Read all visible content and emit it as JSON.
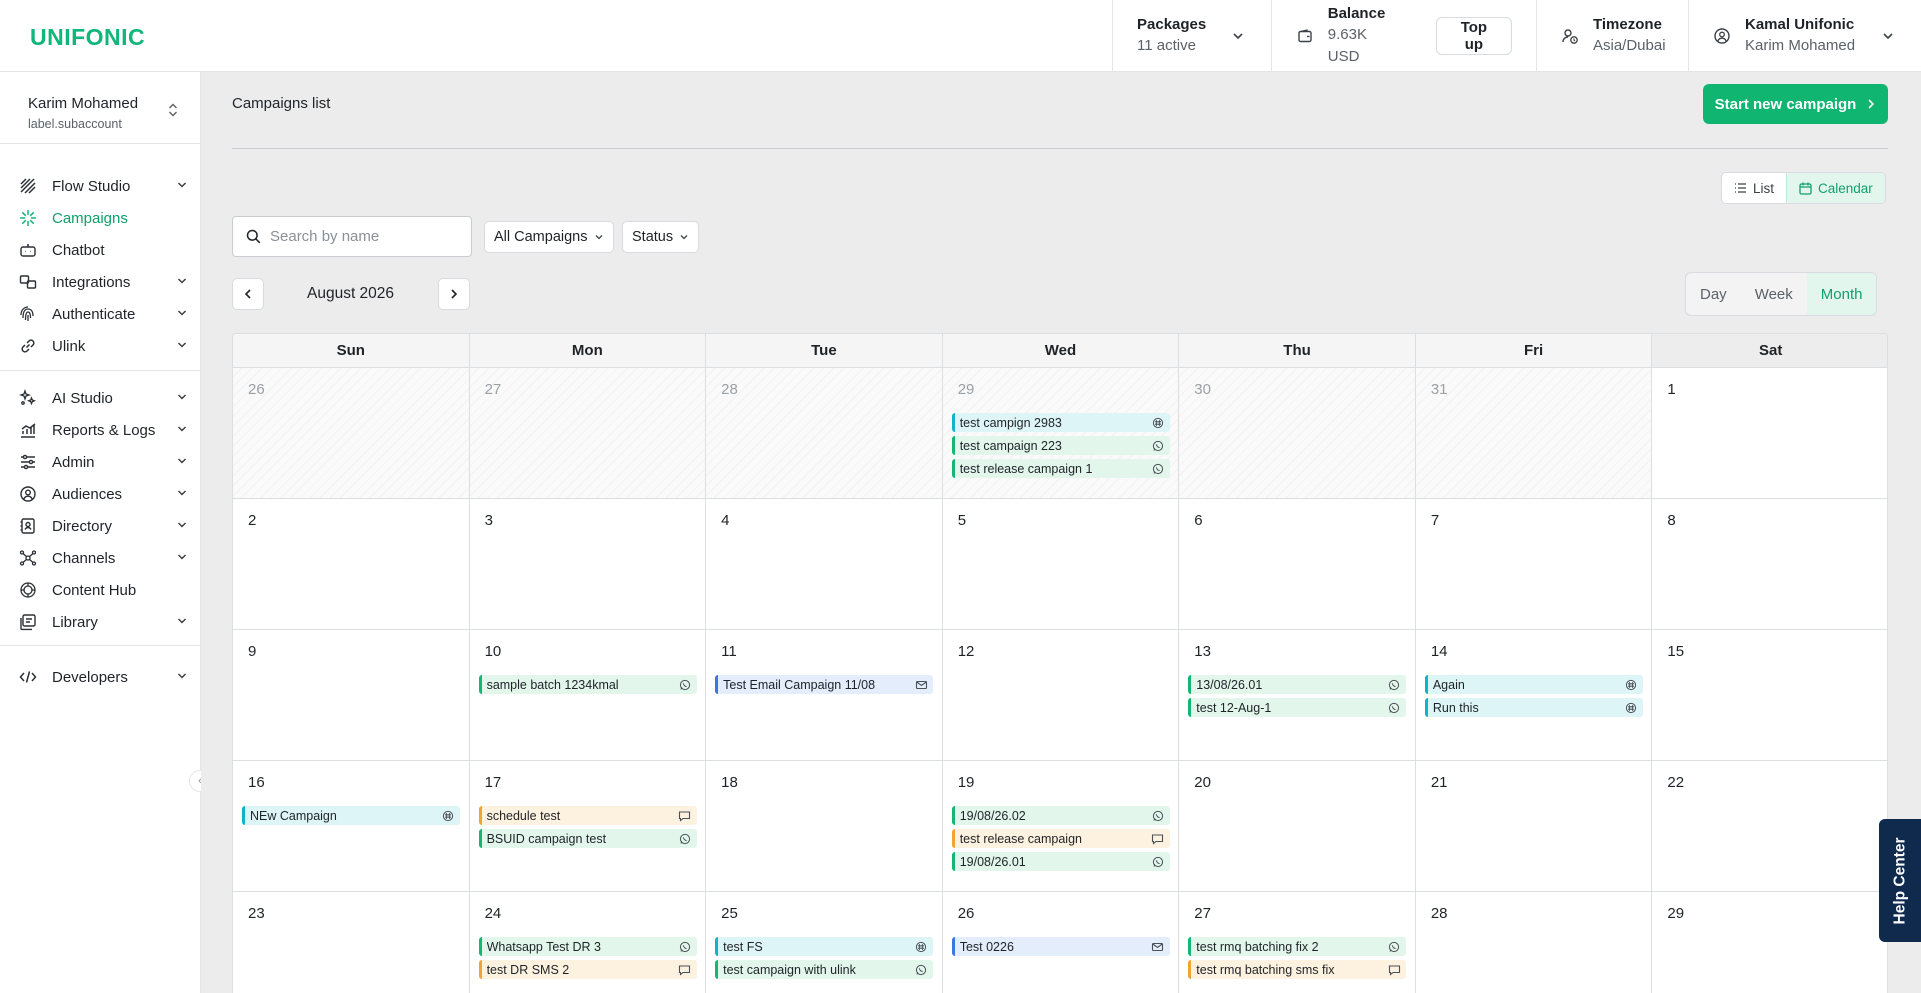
{
  "brand": {
    "logo": "UNIFONIC",
    "accent": "#11b67a",
    "primary_button": "#0fb571"
  },
  "topbar": {
    "packages": {
      "label": "Packages",
      "value": "11 active"
    },
    "balance": {
      "label": "Balance",
      "value": "9.63K USD",
      "topup": "Top up"
    },
    "timezone": {
      "label": "Timezone",
      "value": "Asia/Dubai"
    },
    "user": {
      "name": "Kamal Unifonic",
      "account": "Karim Mohamed"
    }
  },
  "sidebar": {
    "account": {
      "name": "Karim Mohamed",
      "sub": "label.subaccount"
    },
    "items": [
      {
        "label": "Flow Studio",
        "icon": "flow-studio-icon",
        "expandable": true
      },
      {
        "label": "Campaigns",
        "icon": "campaigns-icon",
        "expandable": false,
        "active": true
      },
      {
        "label": "Chatbot",
        "icon": "chatbot-icon",
        "expandable": false
      },
      {
        "label": "Integrations",
        "icon": "integrations-icon",
        "expandable": true
      },
      {
        "label": "Authenticate",
        "icon": "fingerprint-icon",
        "expandable": true
      },
      {
        "label": "Ulink",
        "icon": "link-icon",
        "expandable": true
      },
      {
        "label": "AI Studio",
        "icon": "ai-studio-icon",
        "expandable": true
      },
      {
        "label": "Reports & Logs",
        "icon": "reports-icon",
        "expandable": true
      },
      {
        "label": "Admin",
        "icon": "sliders-icon",
        "expandable": true
      },
      {
        "label": "Audiences",
        "icon": "audiences-icon",
        "expandable": true
      },
      {
        "label": "Directory",
        "icon": "directory-icon",
        "expandable": true
      },
      {
        "label": "Channels",
        "icon": "channels-icon",
        "expandable": true
      },
      {
        "label": "Content Hub",
        "icon": "content-hub-icon",
        "expandable": false
      },
      {
        "label": "Library",
        "icon": "library-icon",
        "expandable": true
      },
      {
        "label": "Developers",
        "icon": "code-icon",
        "expandable": true
      }
    ]
  },
  "main": {
    "title": "Campaigns list",
    "start_button": "Start new campaign",
    "view_toggle": {
      "list": "List",
      "calendar": "Calendar",
      "selected": "Calendar"
    },
    "search": {
      "placeholder": "Search by name",
      "value": ""
    },
    "filters": {
      "campaigns": "All Campaigns",
      "status": "Status"
    },
    "month_label": "August 2026",
    "range": {
      "day": "Day",
      "week": "Week",
      "month": "Month",
      "selected": "Month"
    }
  },
  "calendar": {
    "weekdays": [
      "Sun",
      "Mon",
      "Tue",
      "Wed",
      "Thu",
      "Fri",
      "Sat"
    ],
    "weeks": [
      [
        {
          "day": "26",
          "other": true,
          "events": []
        },
        {
          "day": "27",
          "other": true,
          "events": []
        },
        {
          "day": "28",
          "other": true,
          "events": []
        },
        {
          "day": "29",
          "other": true,
          "events": [
            {
              "name": "test campign 2983",
              "channel": "rcs"
            },
            {
              "name": "test campaign 223",
              "channel": "whatsapp"
            },
            {
              "name": "test release campaign 1",
              "channel": "whatsapp"
            }
          ]
        },
        {
          "day": "30",
          "other": true,
          "events": []
        },
        {
          "day": "31",
          "other": true,
          "events": []
        },
        {
          "day": "1",
          "other": false,
          "events": []
        }
      ],
      [
        {
          "day": "2",
          "other": false,
          "events": []
        },
        {
          "day": "3",
          "other": false,
          "events": []
        },
        {
          "day": "4",
          "other": false,
          "events": []
        },
        {
          "day": "5",
          "other": false,
          "events": []
        },
        {
          "day": "6",
          "other": false,
          "events": []
        },
        {
          "day": "7",
          "other": false,
          "events": []
        },
        {
          "day": "8",
          "other": false,
          "events": []
        }
      ],
      [
        {
          "day": "9",
          "other": false,
          "events": []
        },
        {
          "day": "10",
          "other": false,
          "events": [
            {
              "name": "sample batch 1234kmal",
              "channel": "whatsapp"
            }
          ]
        },
        {
          "day": "11",
          "other": false,
          "events": [
            {
              "name": "Test Email Campaign 11/08",
              "channel": "email"
            }
          ]
        },
        {
          "day": "12",
          "other": false,
          "events": []
        },
        {
          "day": "13",
          "other": false,
          "events": [
            {
              "name": "13/08/26.01",
              "channel": "whatsapp"
            },
            {
              "name": "test 12-Aug-1",
              "channel": "whatsapp"
            }
          ]
        },
        {
          "day": "14",
          "other": false,
          "events": [
            {
              "name": "Again",
              "channel": "rcs"
            },
            {
              "name": "Run this",
              "channel": "rcs"
            }
          ]
        },
        {
          "day": "15",
          "other": false,
          "events": []
        }
      ],
      [
        {
          "day": "16",
          "other": false,
          "events": [
            {
              "name": "NEw Campaign",
              "channel": "rcs"
            }
          ]
        },
        {
          "day": "17",
          "other": false,
          "events": [
            {
              "name": "schedule test",
              "channel": "sms"
            },
            {
              "name": "BSUID campaign test",
              "channel": "whatsapp"
            }
          ]
        },
        {
          "day": "18",
          "other": false,
          "events": []
        },
        {
          "day": "19",
          "other": false,
          "events": [
            {
              "name": "19/08/26.02",
              "channel": "whatsapp"
            },
            {
              "name": "test release campaign",
              "channel": "sms"
            },
            {
              "name": "19/08/26.01",
              "channel": "whatsapp"
            }
          ]
        },
        {
          "day": "20",
          "other": false,
          "events": []
        },
        {
          "day": "21",
          "other": false,
          "events": []
        },
        {
          "day": "22",
          "other": false,
          "events": []
        }
      ],
      [
        {
          "day": "23",
          "other": false,
          "events": []
        },
        {
          "day": "24",
          "other": false,
          "events": [
            {
              "name": "Whatsapp Test DR 3",
              "channel": "whatsapp"
            },
            {
              "name": "test DR SMS 2",
              "channel": "sms"
            }
          ]
        },
        {
          "day": "25",
          "other": false,
          "events": [
            {
              "name": "test FS",
              "channel": "rcs"
            },
            {
              "name": "test campaign with ulink",
              "channel": "whatsapp"
            }
          ]
        },
        {
          "day": "26",
          "other": false,
          "events": [
            {
              "name": "Test 0226",
              "channel": "email"
            }
          ]
        },
        {
          "day": "27",
          "other": false,
          "events": [
            {
              "name": "test rmq batching fix 2",
              "channel": "whatsapp"
            },
            {
              "name": "test rmq batching sms fix",
              "channel": "sms"
            }
          ]
        },
        {
          "day": "28",
          "other": false,
          "events": []
        },
        {
          "day": "29",
          "other": false,
          "events": []
        }
      ]
    ]
  },
  "help_center": "Help Center"
}
